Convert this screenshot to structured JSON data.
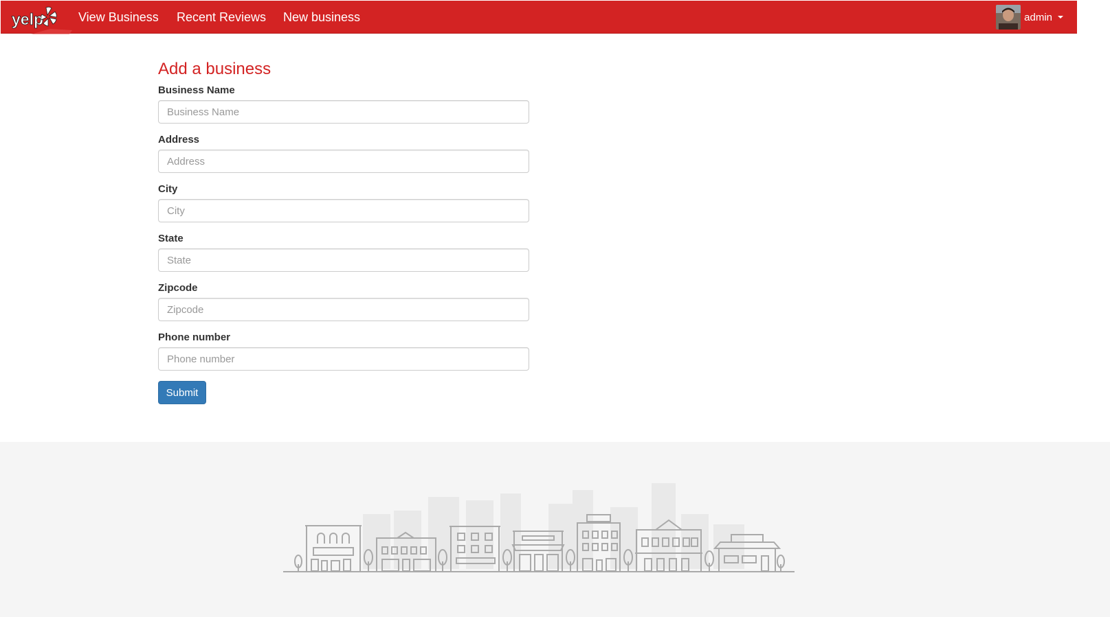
{
  "navbar": {
    "brand": "yelp",
    "links": [
      "View Business",
      "Recent Reviews",
      "New business"
    ],
    "user_name": "admin"
  },
  "form": {
    "title": "Add a business",
    "fields": [
      {
        "label": "Business Name",
        "placeholder": "Business Name",
        "value": ""
      },
      {
        "label": "Address",
        "placeholder": "Address",
        "value": ""
      },
      {
        "label": "City",
        "placeholder": "City",
        "value": ""
      },
      {
        "label": "State",
        "placeholder": "State",
        "value": ""
      },
      {
        "label": "Zipcode",
        "placeholder": "Zipcode",
        "value": ""
      },
      {
        "label": "Phone number",
        "placeholder": "Phone number",
        "value": ""
      }
    ],
    "submit_label": "Submit"
  },
  "colors": {
    "brand_red": "#d32323",
    "primary_blue": "#337ab7",
    "footer_bg": "#f5f5f5"
  },
  "icons": {
    "logo": "yelp-logo",
    "avatar": "user-avatar",
    "dropdown": "caret-down-icon",
    "footer_art": "city-skyline-illustration"
  }
}
